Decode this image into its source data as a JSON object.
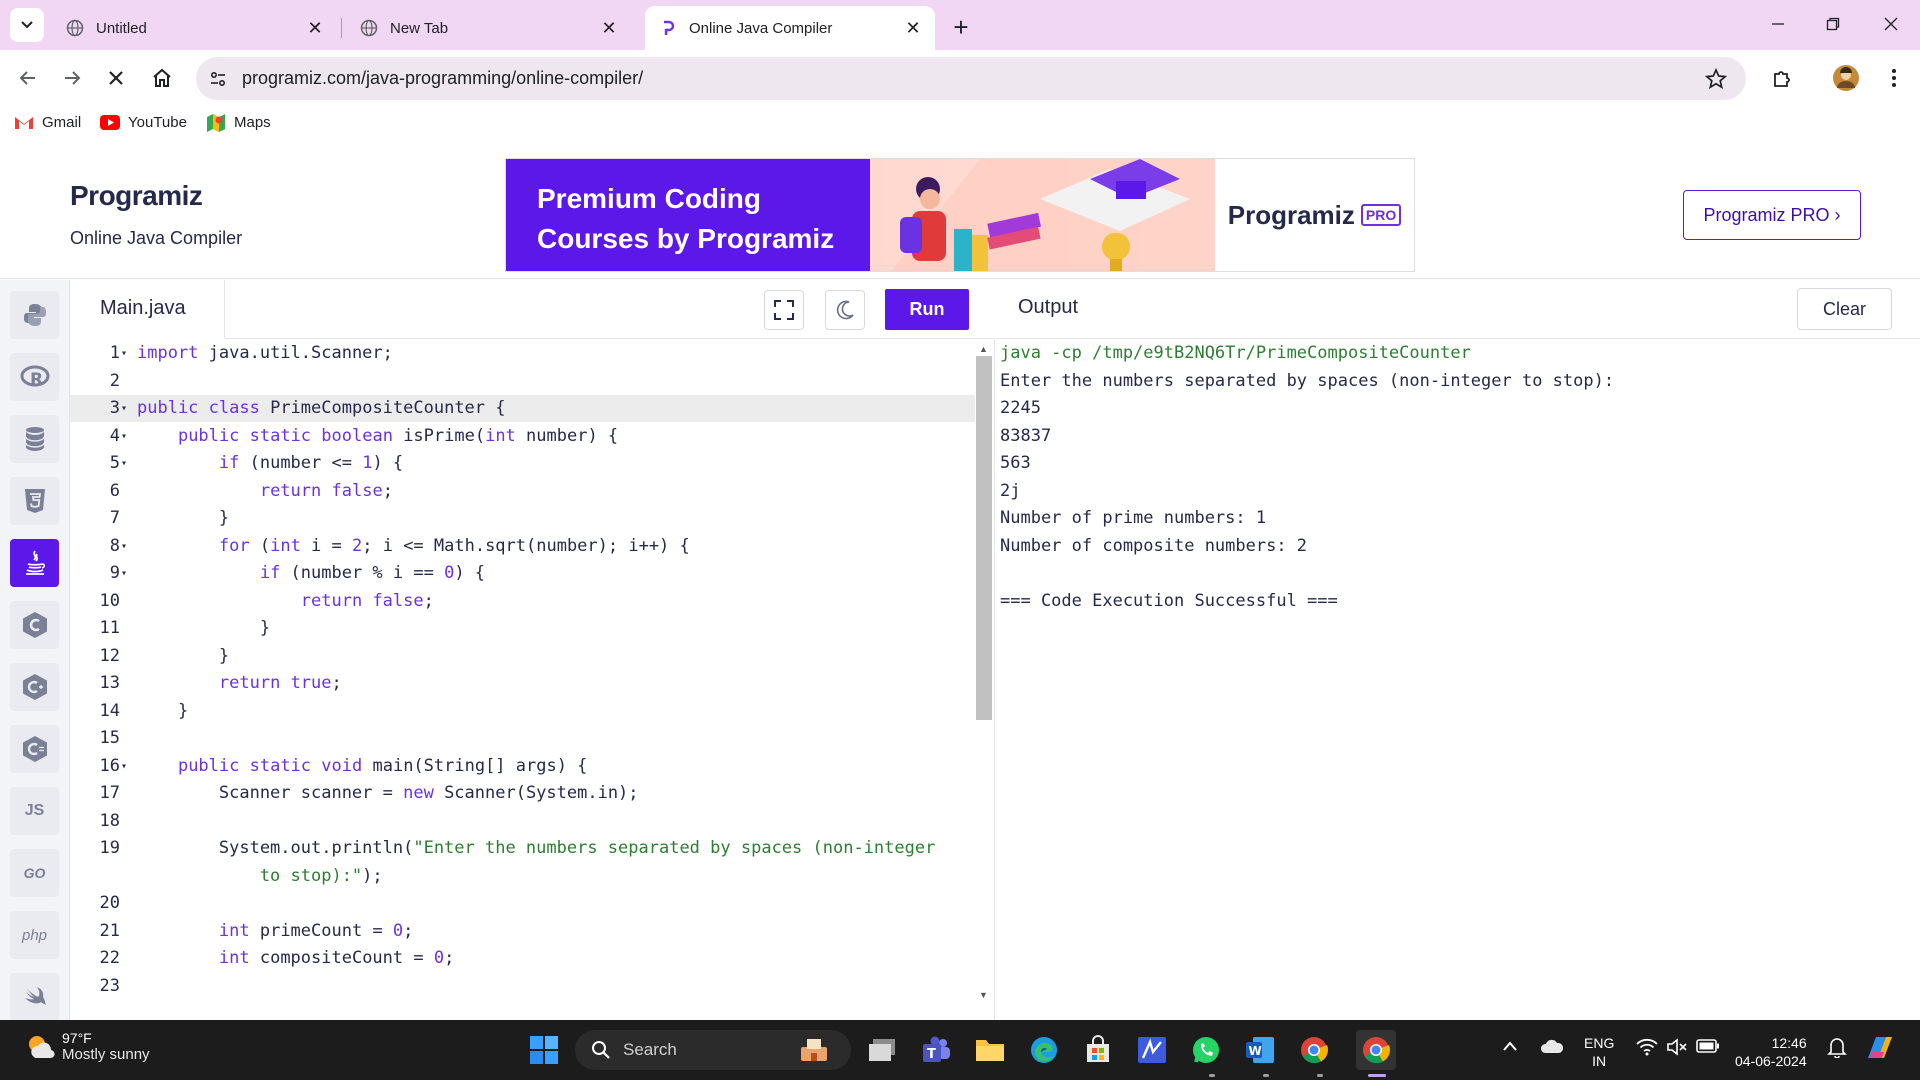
{
  "browser": {
    "tabs": [
      {
        "title": "Untitled",
        "active": false
      },
      {
        "title": "New Tab",
        "active": false
      },
      {
        "title": "Online Java Compiler",
        "active": true
      }
    ],
    "url": "programiz.com/java-programming/online-compiler/",
    "bookmarks": [
      "Gmail",
      "YouTube",
      "Maps"
    ]
  },
  "site": {
    "logo": "Programiz",
    "subtitle": "Online Java Compiler",
    "ad_line1": "Premium Coding",
    "ad_line2": "Courses by Programiz",
    "ad_brand": "Programiz",
    "ad_badge": "PRO",
    "pro_button": "Programiz PRO ›"
  },
  "languages": [
    {
      "name": "python-icon",
      "label": ""
    },
    {
      "name": "r-icon",
      "label": "R"
    },
    {
      "name": "sql-icon",
      "label": ""
    },
    {
      "name": "html5-icon",
      "label": "5"
    },
    {
      "name": "java-icon",
      "label": "",
      "active": true
    },
    {
      "name": "c-icon",
      "label": "C"
    },
    {
      "name": "cpp-icon",
      "label": "C"
    },
    {
      "name": "csharp-icon",
      "label": "C"
    },
    {
      "name": "javascript-icon",
      "label": "JS"
    },
    {
      "name": "go-icon",
      "label": "GO"
    },
    {
      "name": "php-icon",
      "label": "php"
    },
    {
      "name": "swift-icon",
      "label": ""
    }
  ],
  "editor": {
    "file_tab": "Main.java",
    "run_label": "Run",
    "lines": [
      {
        "n": "1",
        "fold": true,
        "html": "<span class='kw'>import</span> java.util.Scanner;"
      },
      {
        "n": "2",
        "fold": false,
        "html": ""
      },
      {
        "n": "3",
        "fold": true,
        "hl": true,
        "html": "<span class='kw'>public</span> <span class='kw'>class</span> PrimeCompositeCounter {"
      },
      {
        "n": "4",
        "fold": true,
        "html": "    <span class='kw'>public</span> <span class='kw'>static</span> <span class='kw'>boolean</span> isPrime(<span class='kw'>int</span> number) {"
      },
      {
        "n": "5",
        "fold": true,
        "html": "        <span class='kw'>if</span> (number &lt;= <span class='num'>1</span>) {"
      },
      {
        "n": "6",
        "fold": false,
        "html": "            <span class='kw'>return</span> <span class='kw'>false</span>;"
      },
      {
        "n": "7",
        "fold": false,
        "html": "        }"
      },
      {
        "n": "8",
        "fold": true,
        "html": "        <span class='kw'>for</span> (<span class='kw'>int</span> i = <span class='num'>2</span>; i &lt;= Math.sqrt(number); i++) {"
      },
      {
        "n": "9",
        "fold": true,
        "html": "            <span class='kw'>if</span> (number % i == <span class='num'>0</span>) {"
      },
      {
        "n": "10",
        "fold": false,
        "html": "                <span class='kw'>return</span> <span class='kw'>false</span>;"
      },
      {
        "n": "11",
        "fold": false,
        "html": "            }"
      },
      {
        "n": "12",
        "fold": false,
        "html": "        }"
      },
      {
        "n": "13",
        "fold": false,
        "html": "        <span class='kw'>return</span> <span class='kw'>true</span>;"
      },
      {
        "n": "14",
        "fold": false,
        "html": "    }"
      },
      {
        "n": "15",
        "fold": false,
        "html": ""
      },
      {
        "n": "16",
        "fold": true,
        "html": "    <span class='kw'>public</span> <span class='kw'>static</span> <span class='kw'>void</span> main(String[] args) {"
      },
      {
        "n": "17",
        "fold": false,
        "html": "        Scanner scanner = <span class='kw'>new</span> Scanner(System.in);"
      },
      {
        "n": "18",
        "fold": false,
        "html": ""
      },
      {
        "n": "19",
        "fold": false,
        "html": "        System.out.println(<span class='str'>\"Enter the numbers separated by spaces (non-integer</span>"
      },
      {
        "n": "",
        "fold": false,
        "html": "<span class='str'>            to stop):\"</span>);"
      },
      {
        "n": "20",
        "fold": false,
        "html": ""
      },
      {
        "n": "21",
        "fold": false,
        "html": "        <span class='kw'>int</span> primeCount = <span class='num'>0</span>;"
      },
      {
        "n": "22",
        "fold": false,
        "html": "        <span class='kw'>int</span> compositeCount = <span class='num'>0</span>;"
      },
      {
        "n": "23",
        "fold": false,
        "html": ""
      }
    ]
  },
  "output": {
    "title": "Output",
    "clear_label": "Clear",
    "lines": [
      {
        "text": "java -cp /tmp/e9tB2NQ6Tr/PrimeCompositeCounter",
        "cmd": true
      },
      {
        "text": "Enter the numbers separated by spaces (non-integer to stop):"
      },
      {
        "text": "2245"
      },
      {
        "text": "83837"
      },
      {
        "text": "563"
      },
      {
        "text": "2j"
      },
      {
        "text": "Number of prime numbers: 1"
      },
      {
        "text": "Number of composite numbers: 2"
      },
      {
        "text": ""
      },
      {
        "text": "=== Code Execution Successful ==="
      }
    ]
  },
  "taskbar": {
    "temperature": "97°F",
    "condition": "Mostly sunny",
    "search": "Search",
    "lang_line1": "ENG",
    "lang_line2": "IN",
    "time": "12:46",
    "date": "04-06-2024"
  },
  "colors": {
    "accent": "#5b18e8",
    "tabstrip": "#f1d7f4",
    "keyword": "#6a32e0",
    "string": "#2e7d32"
  }
}
